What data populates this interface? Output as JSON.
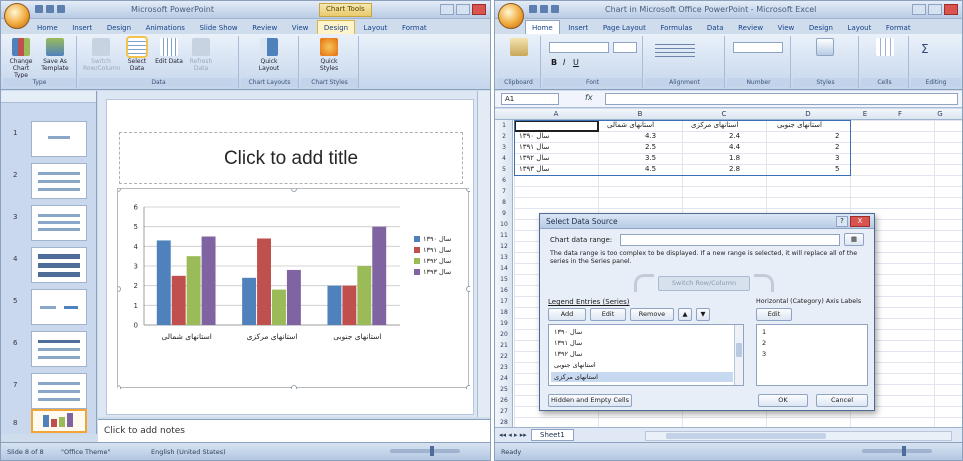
{
  "ppt": {
    "window_title": "Microsoft PowerPoint",
    "tools_label": "Chart Tools",
    "tabs": [
      "Home",
      "Insert",
      "Design",
      "Animations",
      "Slide Show",
      "Review",
      "View",
      "Design",
      "Layout",
      "Format"
    ],
    "ribbon": {
      "groups": [
        {
          "label": "Type",
          "buttons": [
            "Change Chart Type",
            "Save As Template"
          ]
        },
        {
          "label": "Data",
          "buttons": [
            "Switch Row/Column",
            "Select Data",
            "Edit Data",
            "Refresh Data"
          ]
        },
        {
          "label": "Chart Layouts",
          "buttons": [
            "Quick Layout"
          ]
        },
        {
          "label": "Chart Styles",
          "buttons": [
            "Quick Styles"
          ]
        }
      ]
    },
    "slide": {
      "title_placeholder": "Click to add title"
    },
    "notes_placeholder": "Click to add notes",
    "status": {
      "slide_info": "Slide 8 of 8",
      "theme": "\"Office Theme\"",
      "language": "English (United States)"
    },
    "thumbnail_numbers": [
      "1",
      "2",
      "3",
      "4",
      "5",
      "6",
      "7",
      "8"
    ]
  },
  "chart_data": {
    "type": "bar",
    "categories": [
      "استانهای شمالی",
      "استانهای مرکزی",
      "استانهای جنوبی"
    ],
    "series": [
      {
        "name": "سال ۱۳۹۰",
        "values": [
          4.3,
          2.4,
          2.0
        ],
        "color": "#4f81bd"
      },
      {
        "name": "سال ۱۳۹۱",
        "values": [
          2.5,
          4.4,
          2.0
        ],
        "color": "#c0504d"
      },
      {
        "name": "سال ۱۳۹۲",
        "values": [
          3.5,
          1.8,
          3.0
        ],
        "color": "#9bbb59"
      },
      {
        "name": "سال ۱۳۹۳",
        "values": [
          4.5,
          2.8,
          5.0
        ],
        "color": "#8064a2"
      }
    ],
    "ylim": [
      0,
      6
    ],
    "yticks": [
      "0",
      "1",
      "2",
      "3",
      "4",
      "5",
      "6"
    ],
    "grid": true,
    "legend_position": "right"
  },
  "excel": {
    "window_title": "Chart in Microsoft Office PowerPoint - Microsoft Excel",
    "tabs": [
      "Home",
      "Insert",
      "Page Layout",
      "Formulas",
      "Data",
      "Review",
      "View",
      "Design",
      "Layout",
      "Format"
    ],
    "ribbon_groups": [
      "Clipboard",
      "Font",
      "Alignment",
      "Number",
      "Styles",
      "Cells",
      "Editing"
    ],
    "name_box": "A1",
    "fx": "fx",
    "columns": [
      "A",
      "B",
      "C",
      "D",
      "E",
      "F",
      "G"
    ],
    "rows": [
      "1",
      "2",
      "3",
      "4",
      "5",
      "6",
      "7",
      "8",
      "9",
      "10",
      "11",
      "12",
      "13",
      "14",
      "15",
      "16",
      "17",
      "18",
      "19",
      "20",
      "21",
      "22",
      "23",
      "24",
      "25",
      "26",
      "27",
      "28"
    ],
    "table": {
      "header": [
        "استانهای شمالی",
        "استانهای مرکزی",
        "استانهای جنوبی"
      ],
      "rows": [
        {
          "label": "سال ۱۳۹۰",
          "values": [
            "4.3",
            "2.4",
            "2"
          ]
        },
        {
          "label": "سال ۱۳۹۱",
          "values": [
            "2.5",
            "4.4",
            "2"
          ]
        },
        {
          "label": "سال ۱۳۹۲",
          "values": [
            "3.5",
            "1.8",
            "3"
          ]
        },
        {
          "label": "سال ۱۳۹۳",
          "values": [
            "4.5",
            "2.8",
            "5"
          ]
        }
      ]
    },
    "sheet_tab": "Sheet1",
    "status": "Ready"
  },
  "dialog": {
    "title": "Select Data Source",
    "help": "?",
    "close": "X",
    "chart_range_label": "Chart data range:",
    "info_text": "The data range is too complex to be displayed. If a new range is selected, it will replace all of the series in the Series panel.",
    "switch_label": "Switch Row/Column",
    "legend_label": "Legend Entries (Series)",
    "axis_label": "Horizontal (Category) Axis Labels",
    "add": "Add",
    "edit": "Edit",
    "remove": "Remove",
    "axis_edit": "Edit",
    "series_items": [
      "سال ۱۳۹۰",
      "سال ۱۳۹۱",
      "سال ۱۳۹۲",
      "استانهای جنوبی",
      "استانهای مرکزی"
    ],
    "axis_items": [
      "1",
      "2",
      "3"
    ],
    "hidden_cells": "Hidden and Empty Cells",
    "ok": "OK",
    "cancel": "Cancel"
  }
}
